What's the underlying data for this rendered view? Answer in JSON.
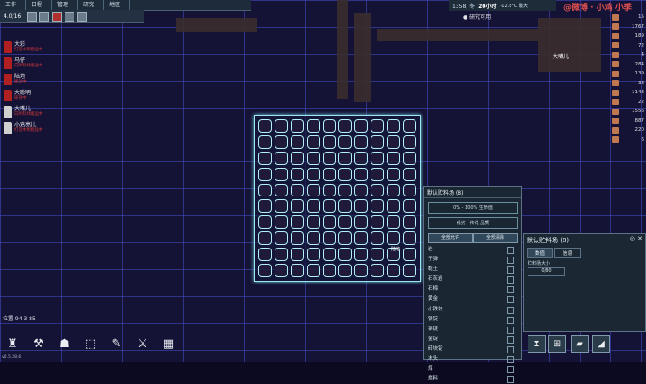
{
  "menu": [
    "工作",
    "日程",
    "管理",
    "研究",
    "地区"
  ],
  "speed": "4.0/16",
  "colonists": [
    {
      "name": "大彩",
      "task": "打造木制物品中",
      "color": "red"
    },
    {
      "name": "马仔",
      "task": "向贮料场搬运中",
      "color": "red"
    },
    {
      "name": "陆地",
      "task": "搬运中",
      "color": "red"
    },
    {
      "name": "大聪明",
      "task": "研究中",
      "color": "red"
    },
    {
      "name": "大嘴儿",
      "task": "向贮料场搬运中",
      "color": "white"
    },
    {
      "name": "小鸡亮儿",
      "task": "打造木制物品中",
      "color": "white"
    }
  ],
  "time": {
    "date": "1358, 冬",
    "clock": "20小时",
    "temp": "-12.8°C 最大"
  },
  "research": "研究可用",
  "resources": [
    "15",
    "1767",
    "189",
    "72",
    "4",
    "284",
    "139",
    "38",
    "1143",
    "22",
    "1556",
    "887",
    "220",
    "6"
  ],
  "npc_name": "大嘴儿",
  "unit_name": "陆地",
  "stockpile": {
    "title": "默认贮料场 (8)",
    "quality_range": "0% - 100% 生命值",
    "quality_label": "低劣 - 传说 品质",
    "btn_clear": "全部允许",
    "btn_allow": "全部清除",
    "items": [
      "岩",
      "子弹",
      "黏土",
      "石灰岩",
      "石棉",
      "黄金",
      "小铁块",
      "铁锭",
      "钢锭",
      "金锭",
      "砖块锭",
      "木头",
      "煤",
      "燃料"
    ]
  },
  "panel": {
    "title": "默认贮料场 (8)",
    "controls": "◎ ✕",
    "tab_stats": "数值",
    "tab_info": "信息",
    "capacity_label": "贮料场大小",
    "capacity_value": "0/80"
  },
  "position": "位置 94 3 85",
  "version": "v0.5.28.6",
  "watermark": "@微博 · 小鸡 小季"
}
